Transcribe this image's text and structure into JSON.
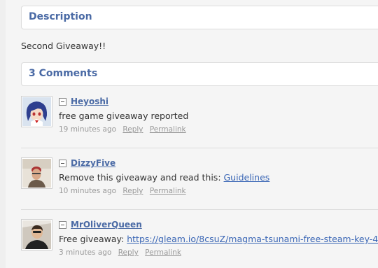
{
  "description_section": {
    "title": "Description",
    "text": "Second Giveaway!!"
  },
  "comments_section": {
    "title": "3 Comments",
    "comments": [
      {
        "author": "Heyoshi",
        "text": "free game giveaway reported",
        "link": "",
        "time": "19 minutes ago",
        "reply": "Reply",
        "permalink": "Permalink",
        "avatar": "anime-avatar-icon"
      },
      {
        "author": "DizzyFive",
        "text": "Remove this giveaway and read this: ",
        "link": "Guidelines",
        "time": "10 minutes ago",
        "reply": "Reply",
        "permalink": "Permalink",
        "avatar": "person-avatar-icon"
      },
      {
        "author": "MrOliverQueen",
        "text": "Free giveaway: ",
        "link": "https://gleam.io/8csuZ/magma-tsunami-free-steam-key-4",
        "time": "3 minutes ago",
        "reply": "Reply",
        "permalink": "Permalink",
        "avatar": "person-avatar-icon"
      }
    ]
  },
  "colors": {
    "header_text": "#4a6aa5",
    "link": "#3a66b5",
    "meta_text": "#999999",
    "background": "#f5f5f5"
  }
}
